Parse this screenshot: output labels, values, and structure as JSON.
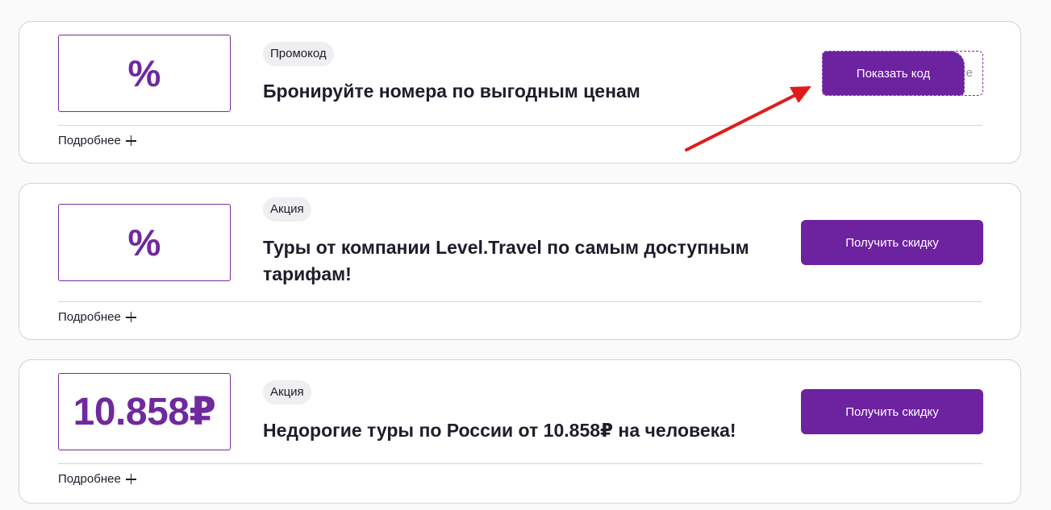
{
  "offers": [
    {
      "value": "%",
      "badge": "Промокод",
      "title": "Бронируйте номера по выгодным ценам",
      "more_label": "Подробнее",
      "button_label": "Показать код",
      "code_peek": "е"
    },
    {
      "value": "%",
      "badge": "Акция",
      "title": "Туры от компании Level.Travel по самым доступным тарифам!",
      "more_label": "Подробнее",
      "button_label": "Получить скидку"
    },
    {
      "value": "10.858₽",
      "badge": "Акция",
      "title": "Недорогие туры по России от 10.858₽ на человека!",
      "more_label": "Подробнее",
      "button_label": "Получить скидку"
    }
  ],
  "icons": {
    "more": "plus-icon",
    "annotation": "red-arrow-icon"
  },
  "colors": {
    "accent": "#6d22a0",
    "annotation_arrow": "#e01b1b",
    "badge_bg": "#efeff1"
  }
}
